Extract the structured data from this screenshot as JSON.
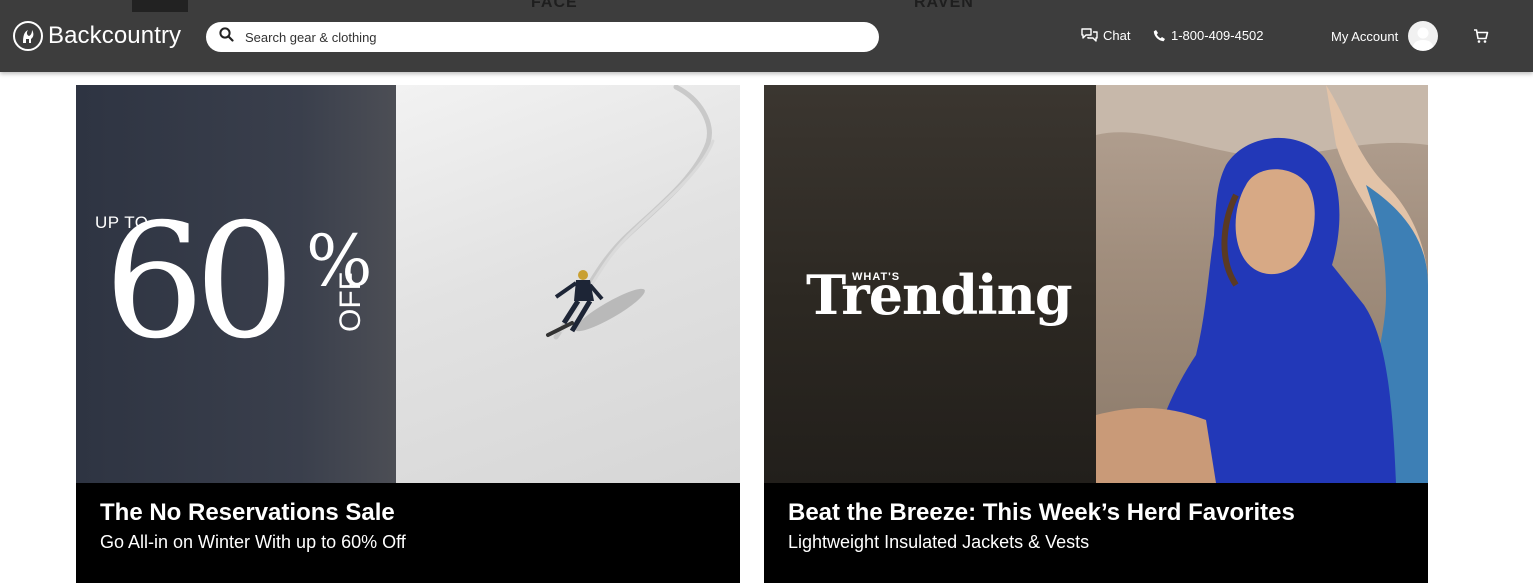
{
  "header": {
    "brand_name": "Backcountry",
    "logo_icon": "goat-logo-icon",
    "top_brands": [
      "FACE",
      "RAVEN"
    ],
    "search": {
      "placeholder": "Search gear & clothing",
      "value": "",
      "icon": "search-icon"
    },
    "chat": {
      "label": "Chat",
      "icon": "chat-bubbles-icon"
    },
    "phone": {
      "label": "1-800-409-4502",
      "icon": "phone-icon"
    },
    "account": {
      "label": "My Account",
      "icon": "avatar-icon"
    },
    "cart": {
      "icon": "cart-icon"
    },
    "colors": {
      "bar": "#3d3d3d",
      "text": "#ffffff"
    }
  },
  "promos": [
    {
      "image_text": {
        "up_to": "UP TO",
        "amount": "60",
        "percent": "%",
        "off": "OFF"
      },
      "title": "The No Reservations Sale",
      "subtitle": "Go All-in on Winter With up to 60% Off"
    },
    {
      "image_text": {
        "kicker": "WHAT'S",
        "headline": "Trending"
      },
      "title": "Beat the Breeze: This Week’s Herd Favorites",
      "subtitle": "Lightweight Insulated Jackets & Vests"
    }
  ]
}
